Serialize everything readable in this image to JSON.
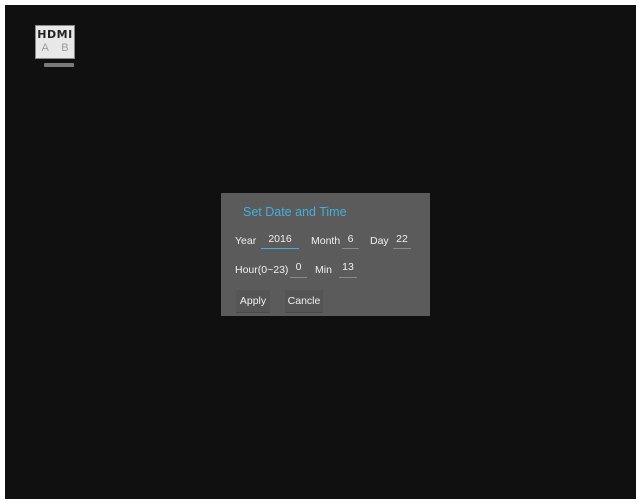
{
  "hdmi_logo": {
    "brand": "HDMI",
    "inputs": "A B"
  },
  "dialog": {
    "title": "Set Date and Time",
    "year_label": "Year",
    "year_value": "2016",
    "month_label": "Month",
    "month_value": "6",
    "day_label": "Day",
    "day_value": "22",
    "hour_label": "Hour(0~23)",
    "hour_value": "0",
    "min_label": "Min",
    "min_value": "13",
    "apply_label": "Apply",
    "cancel_label": "Cancle"
  },
  "colors": {
    "background": "#101010",
    "dialog_bg": "#5b5b5b",
    "accent": "#41b0dd"
  }
}
